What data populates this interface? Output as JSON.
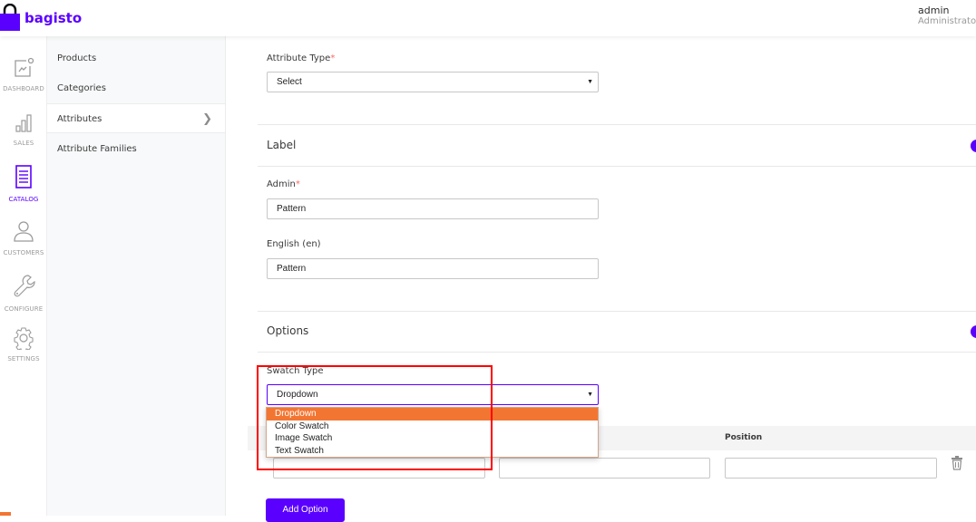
{
  "app": {
    "brand": "bagisto",
    "brand_color": "#5a00ff",
    "user": {
      "name": "admin",
      "role": "Administrator"
    }
  },
  "nav": {
    "items": [
      {
        "label": "DASHBOARD",
        "icon": "dashboard-icon"
      },
      {
        "label": "SALES",
        "icon": "bar-chart-icon"
      },
      {
        "label": "CATALOG",
        "icon": "catalog-icon",
        "active": true
      },
      {
        "label": "CUSTOMERS",
        "icon": "user-icon"
      },
      {
        "label": "CONFIGURE",
        "icon": "wrench-icon"
      },
      {
        "label": "SETTINGS",
        "icon": "gear-icon"
      }
    ]
  },
  "subnav": {
    "items": [
      {
        "label": "Products"
      },
      {
        "label": "Categories"
      },
      {
        "label": "Attributes",
        "active": true
      },
      {
        "label": "Attribute Families"
      }
    ]
  },
  "form": {
    "attribute_type": {
      "label": "Attribute Type",
      "required_mark": "*",
      "value": "Select"
    },
    "label_section": {
      "title": "Label",
      "admin": {
        "label": "Admin",
        "required_mark": "*",
        "value": "Pattern"
      },
      "english": {
        "label": "English (en)",
        "value": "Pattern"
      }
    },
    "options_section": {
      "title": "Options",
      "swatch_type": {
        "label": "Swatch Type",
        "value": "Dropdown",
        "options": [
          "Dropdown",
          "Color Swatch",
          "Image Swatch",
          "Text Swatch"
        ],
        "highlighted": "Dropdown"
      },
      "table": {
        "headers": [
          "Position"
        ],
        "rows": [
          {
            "admin": "",
            "en": "",
            "position": ""
          }
        ]
      },
      "add_button": "Add Option"
    }
  },
  "colors": {
    "accent": "#5a00ff",
    "dropdown_highlight": "#f37532",
    "annotation_box": "#ff0000"
  }
}
